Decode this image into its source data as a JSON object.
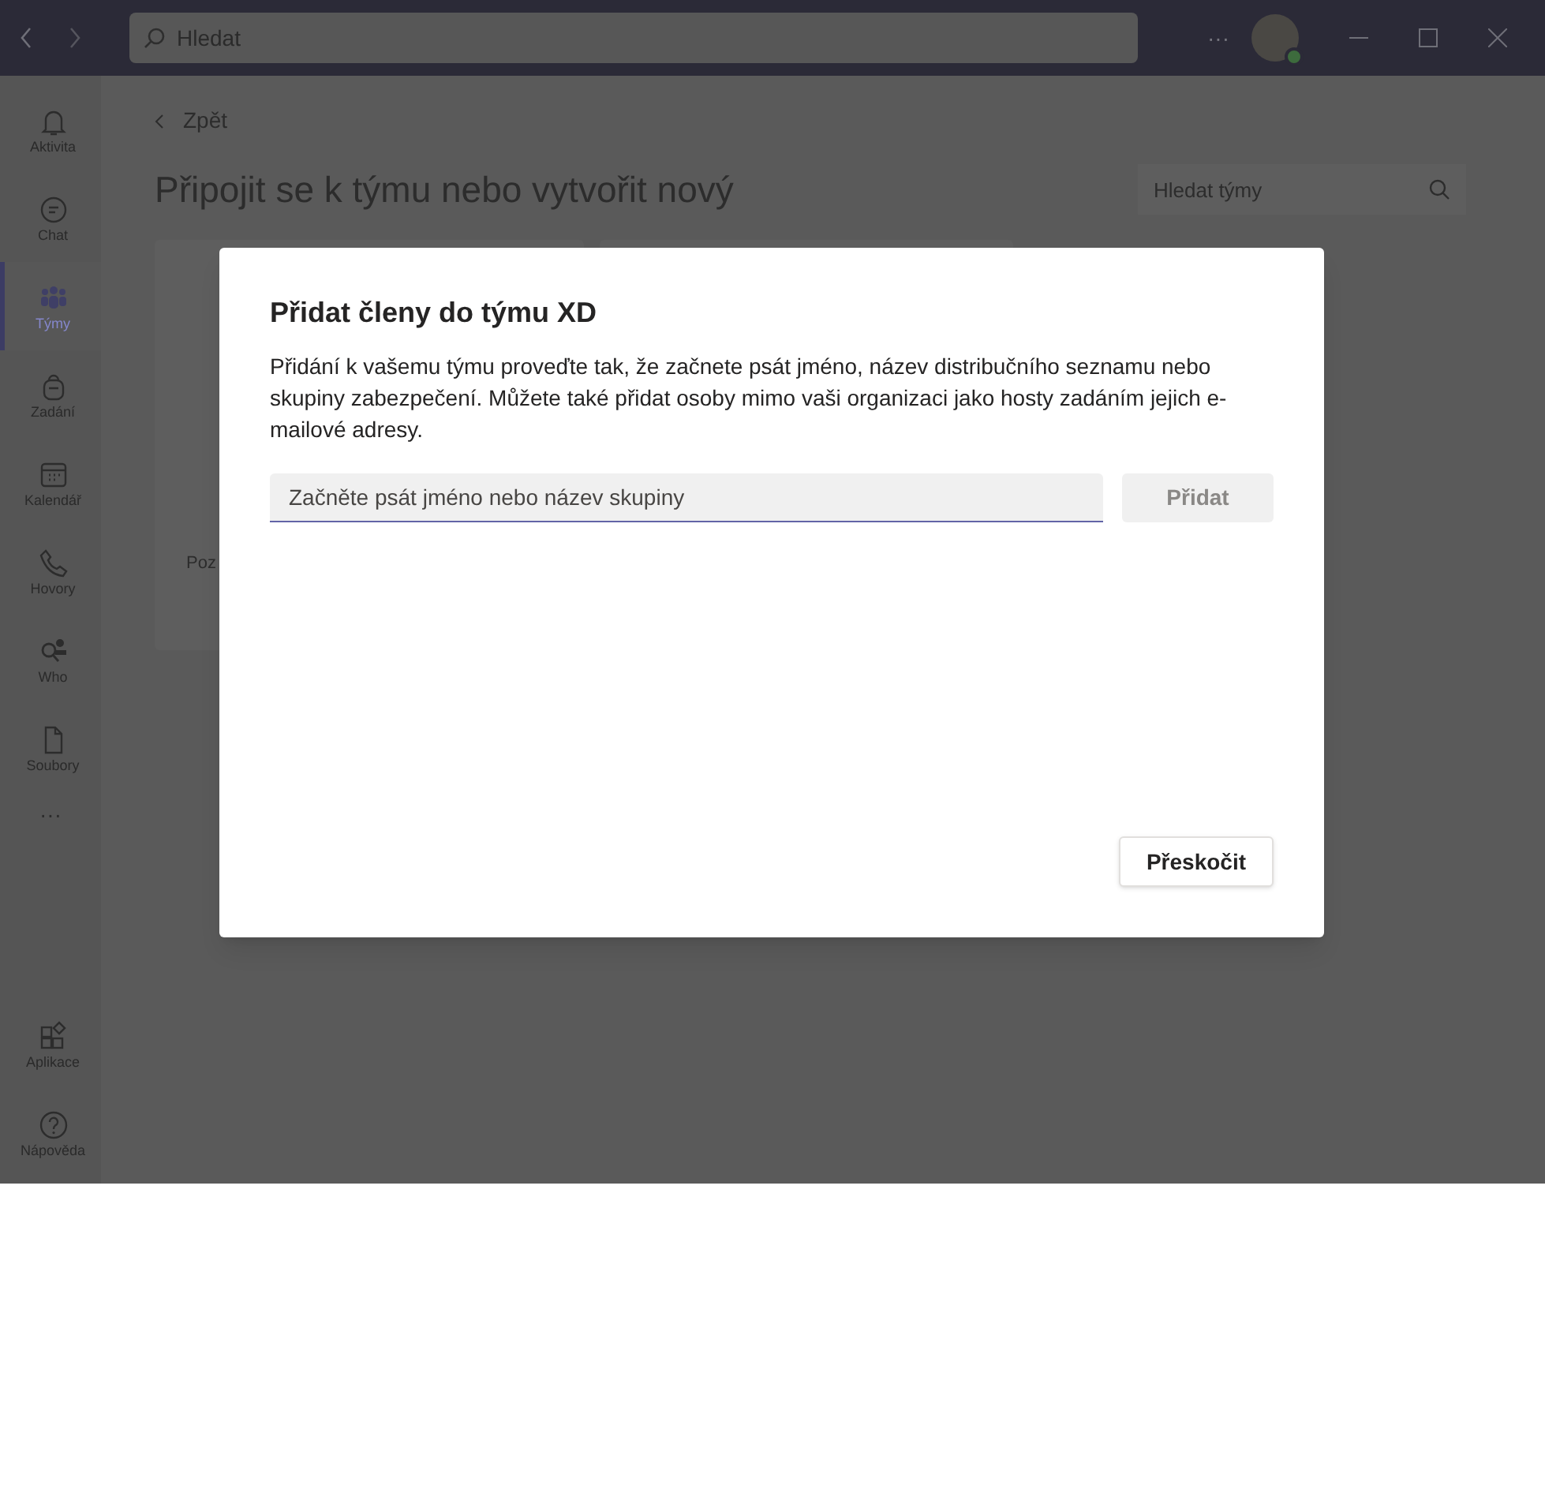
{
  "title_bar": {
    "search": {
      "placeholder": "Hledat"
    },
    "more": "···"
  },
  "sidebar": {
    "items": [
      {
        "label": "Aktivita",
        "selected": false
      },
      {
        "label": "Chat",
        "selected": false
      },
      {
        "label": "Týmy",
        "selected": true
      },
      {
        "label": "Zadání",
        "selected": false
      },
      {
        "label": "Kalendář",
        "selected": false
      },
      {
        "label": "Hovory",
        "selected": false
      },
      {
        "label": "Who",
        "selected": false
      },
      {
        "label": "Soubory",
        "selected": false
      }
    ],
    "more": "···",
    "bottom_items": [
      {
        "label": "Aplikace",
        "selected": false
      },
      {
        "label": "Nápověda",
        "selected": false
      }
    ]
  },
  "page": {
    "back": "Zpět",
    "title": "Připojit se k týmu nebo vytvořit nový",
    "search": {
      "placeholder": "Hledat týmy"
    },
    "card_text": "Poz"
  },
  "dialog": {
    "title": "Přidat členy do týmu XD",
    "description": "Přidání k vašemu týmu proveďte tak, že začnete psát jméno, název distribučního seznamu nebo skupiny zabezpečení. Můžete také přidat osoby mimo vaši organizaci jako hosty zadáním jejich e-mailové adresy.",
    "input": {
      "placeholder": "Začněte psát jméno nebo název skupiny"
    },
    "add_button": {
      "label": "Přidat",
      "disabled": true
    },
    "skip_button": "Přeskočit"
  }
}
